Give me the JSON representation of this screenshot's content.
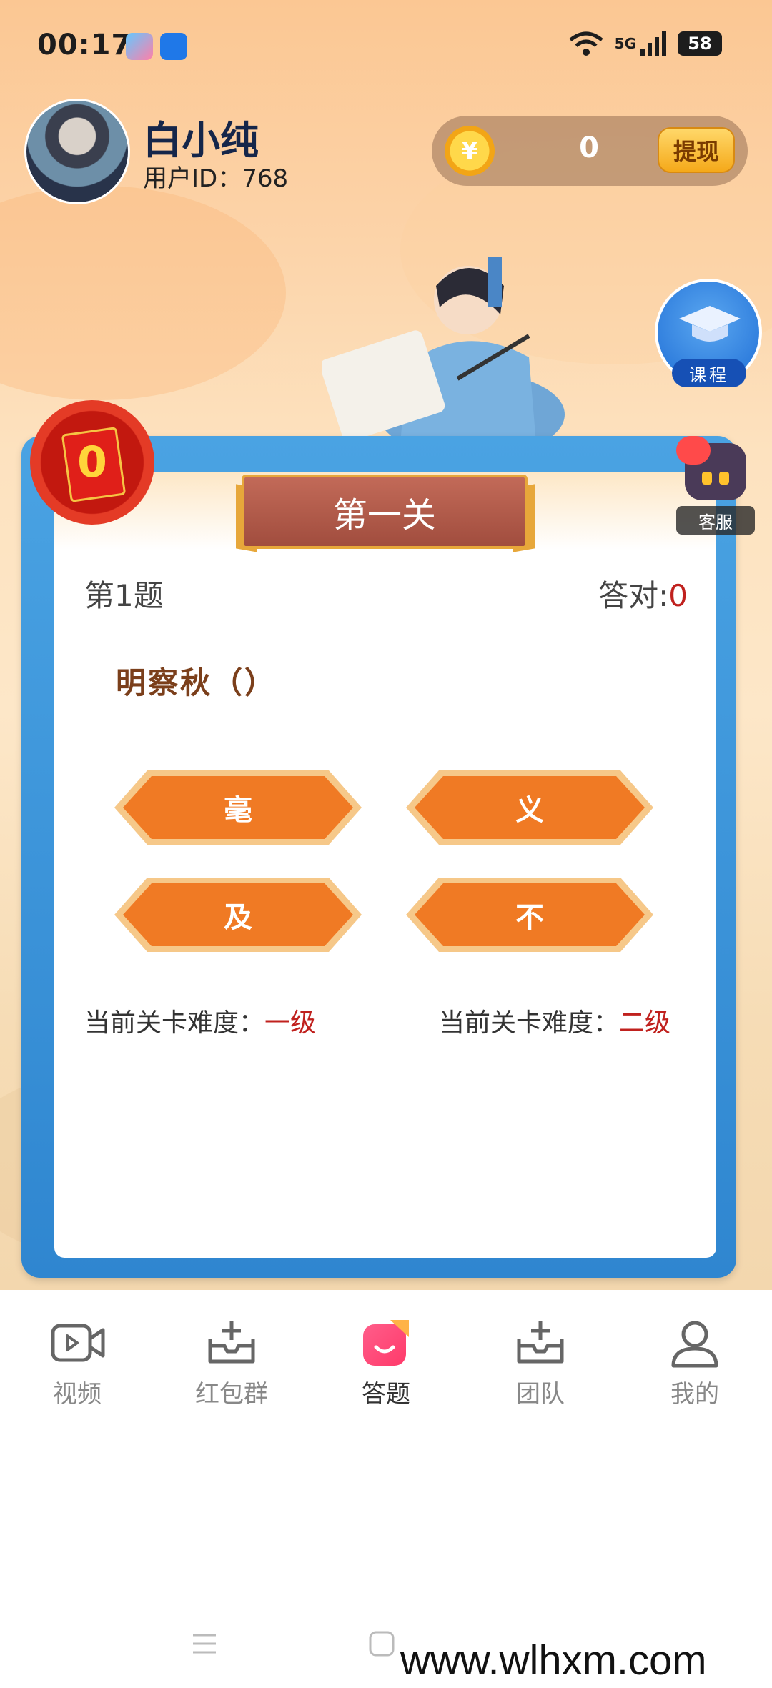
{
  "status": {
    "time": "00:17",
    "network": "5G",
    "battery": "58"
  },
  "header": {
    "user_name": "白小纯",
    "user_id": "用户ID：768",
    "coins": "0",
    "withdraw_label": "提现"
  },
  "course": {
    "label": "课程"
  },
  "service": {
    "label": "客服"
  },
  "redpacket": {
    "count": "0"
  },
  "quiz": {
    "level_title": "第一关",
    "question_number": "第1题",
    "correct_label": "答对:",
    "correct_count": "0",
    "question": "明察秋（）",
    "options": [
      "毫",
      "义",
      "及",
      "不"
    ],
    "difficulty_label": "当前关卡难度：",
    "difficulty_left": "一级",
    "difficulty_right": "二级"
  },
  "tabs": [
    {
      "label": "视频",
      "icon": "video-icon"
    },
    {
      "label": "红包群",
      "icon": "inbox-add-icon"
    },
    {
      "label": "答题",
      "icon": "quiz-icon"
    },
    {
      "label": "团队",
      "icon": "inbox-add-icon"
    },
    {
      "label": "我的",
      "icon": "user-icon"
    }
  ],
  "active_tab": 2,
  "watermark": "www.wlhxm.com",
  "colors": {
    "accent": "#c0211e",
    "frame": "#3b93da",
    "option": "#f07a24"
  }
}
